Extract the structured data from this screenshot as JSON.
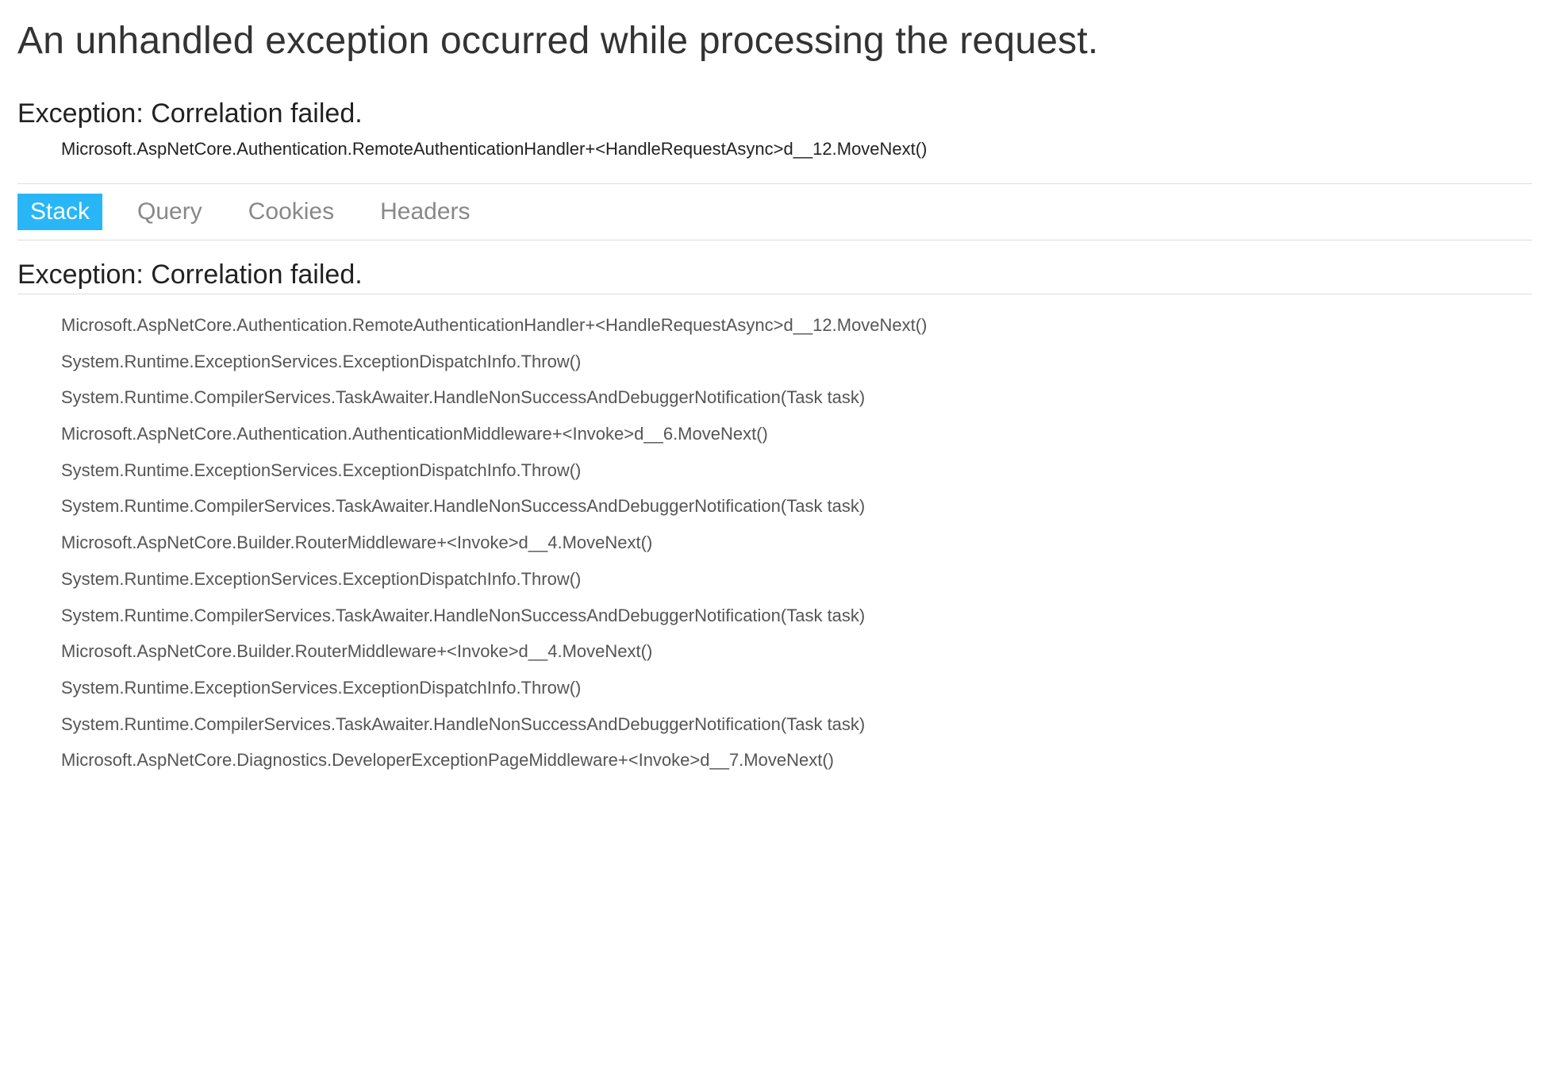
{
  "header": {
    "title": "An unhandled exception occurred while processing the request."
  },
  "exception": {
    "summary": "Exception: Correlation failed.",
    "source": "Microsoft.AspNetCore.Authentication.RemoteAuthenticationHandler+<HandleRequestAsync>d__12.MoveNext()"
  },
  "tabs": {
    "items": [
      {
        "label": "Stack",
        "active": true
      },
      {
        "label": "Query",
        "active": false
      },
      {
        "label": "Cookies",
        "active": false
      },
      {
        "label": "Headers",
        "active": false
      }
    ]
  },
  "stack": {
    "heading": "Exception: Correlation failed.",
    "frames": [
      "Microsoft.AspNetCore.Authentication.RemoteAuthenticationHandler+<HandleRequestAsync>d__12.MoveNext()",
      "System.Runtime.ExceptionServices.ExceptionDispatchInfo.Throw()",
      "System.Runtime.CompilerServices.TaskAwaiter.HandleNonSuccessAndDebuggerNotification(Task task)",
      "Microsoft.AspNetCore.Authentication.AuthenticationMiddleware+<Invoke>d__6.MoveNext()",
      "System.Runtime.ExceptionServices.ExceptionDispatchInfo.Throw()",
      "System.Runtime.CompilerServices.TaskAwaiter.HandleNonSuccessAndDebuggerNotification(Task task)",
      "Microsoft.AspNetCore.Builder.RouterMiddleware+<Invoke>d__4.MoveNext()",
      "System.Runtime.ExceptionServices.ExceptionDispatchInfo.Throw()",
      "System.Runtime.CompilerServices.TaskAwaiter.HandleNonSuccessAndDebuggerNotification(Task task)",
      "Microsoft.AspNetCore.Builder.RouterMiddleware+<Invoke>d__4.MoveNext()",
      "System.Runtime.ExceptionServices.ExceptionDispatchInfo.Throw()",
      "System.Runtime.CompilerServices.TaskAwaiter.HandleNonSuccessAndDebuggerNotification(Task task)",
      "Microsoft.AspNetCore.Diagnostics.DeveloperExceptionPageMiddleware+<Invoke>d__7.MoveNext()"
    ]
  }
}
